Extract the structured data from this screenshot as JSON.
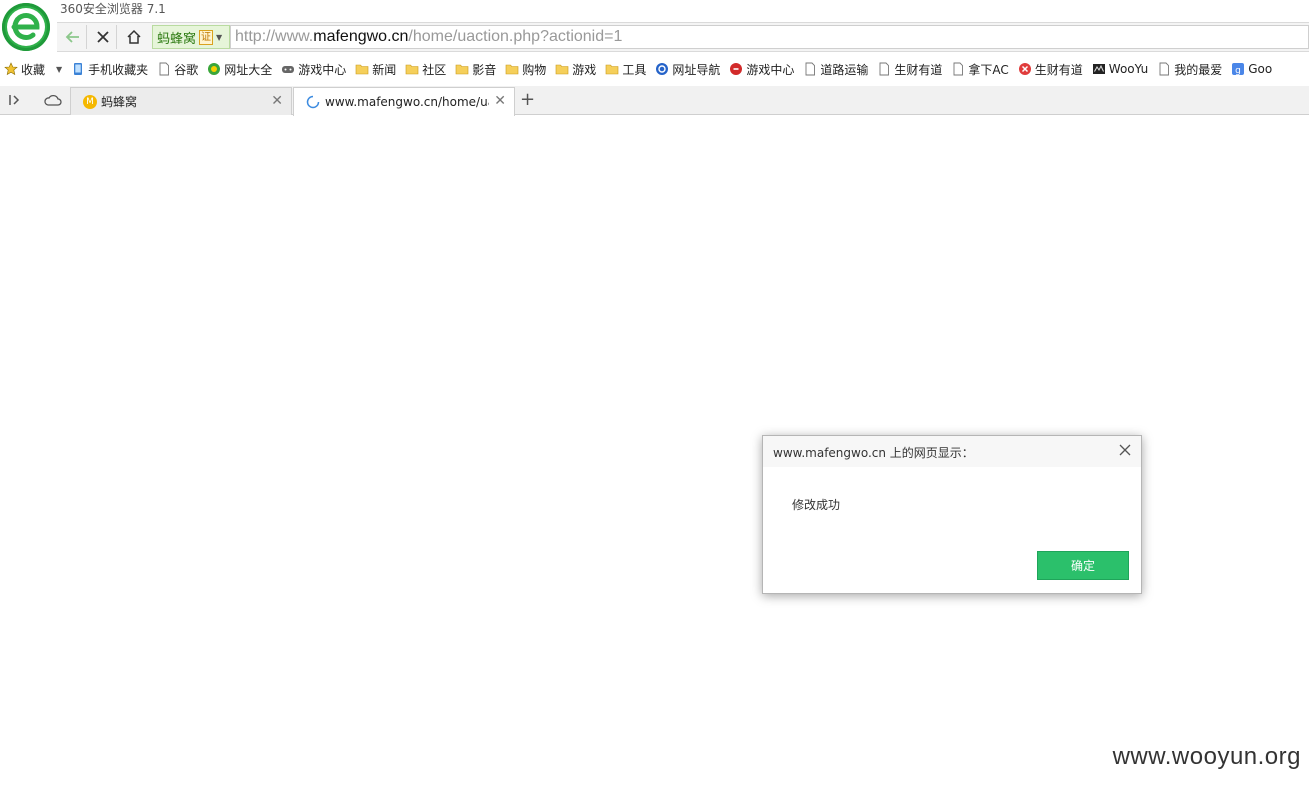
{
  "window": {
    "title": "360安全浏览器 7.1"
  },
  "navbar": {
    "site_badge": "蚂蜂窝",
    "cert_label": "证",
    "url_prefix": "http://www.",
    "url_domain": "mafengwo.cn",
    "url_path": "/home/uaction.php?actionid=1"
  },
  "bookmarks": [
    {
      "label": "收藏",
      "icon": "star-icon"
    },
    {
      "label": "手机收藏夹",
      "icon": "phone-icon"
    },
    {
      "label": "谷歌",
      "icon": "page-icon"
    },
    {
      "label": "网址大全",
      "icon": "nav-site-icon"
    },
    {
      "label": "游戏中心",
      "icon": "gamepad-icon"
    },
    {
      "label": "新闻",
      "icon": "folder-icon"
    },
    {
      "label": "社区",
      "icon": "folder-icon"
    },
    {
      "label": "影音",
      "icon": "folder-icon"
    },
    {
      "label": "购物",
      "icon": "folder-icon"
    },
    {
      "label": "游戏",
      "icon": "folder-icon"
    },
    {
      "label": "工具",
      "icon": "folder-icon"
    },
    {
      "label": "网址导航",
      "icon": "sogou-icon"
    },
    {
      "label": "游戏中心",
      "icon": "game-red-icon"
    },
    {
      "label": "道路运输",
      "icon": "page-icon"
    },
    {
      "label": "生财有道",
      "icon": "page-icon"
    },
    {
      "label": "拿下AC",
      "icon": "page-icon"
    },
    {
      "label": "生财有道",
      "icon": "red-x-icon"
    },
    {
      "label": "WooYu",
      "icon": "wooyun-icon"
    },
    {
      "label": "我的最爱",
      "icon": "page-icon"
    },
    {
      "label": "Goo",
      "icon": "google-icon"
    }
  ],
  "tabs": [
    {
      "label": "蚂蜂窝",
      "icon": "mafengwo-icon"
    },
    {
      "label": "www.mafengwo.cn/home/ua",
      "icon": "loading-icon"
    }
  ],
  "dialog": {
    "title": "www.mafengwo.cn 上的网页显示：",
    "message": "修改成功",
    "ok_label": "确定"
  },
  "watermark": "www.wooyun.org",
  "colors": {
    "accent_green": "#2bc06b",
    "logo_green": "#2fb14a"
  }
}
